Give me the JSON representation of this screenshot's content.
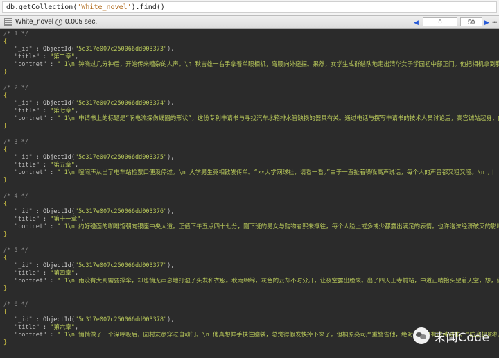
{
  "query": {
    "prefix": "db.getCollection(",
    "collection_arg": "'White_novel'",
    "suffix": ").find()"
  },
  "toolbar": {
    "collection_name": "White_novel",
    "elapsed": "0.005 sec.",
    "page_from": "0",
    "page_to": "50",
    "prev_label": "◀",
    "next_label": "▶",
    "more_label": "•••"
  },
  "documents": [
    {
      "comment": "/* 1 */",
      "id_value": "\"5c317e007c250066dd003373\"",
      "title": "\"第二章\"",
      "contnet": "\"    1\\n    钟晓过几分钟后，开始传来嘈杂的人声。\\n    秋吉雄一右手拿着单眼相机，弯腰向外窥探。果然，女学生成群结队地走出清华女子学园初中部正门。他把相机拿到胸前，"
    },
    {
      "comment": "/* 2 */",
      "id_value": "\"5c317e007c250066dd003374\"",
      "title": "\"第七章\"",
      "contnet": "\"    1\\n    申请书上的标题是“涡电流探伤线圈的形状”，这份专利申请书与寻找汽车水箱排水管缺损的器具有关。通过电话与撰写申请书的技术人员讨论后，高宫诚站起身，向并排摆"
    },
    {
      "comment": "/* 3 */",
      "id_value": "\"5c317e007c250066dd003375\"",
      "title": "\"第五章\"",
      "contnet": "\"    1\\n    喧闹声从出了电车站检票口便没停过。\\n    大学男生竟相散发传单。“××大学网球社，请看一看。”由于一直扯着嗓咙高声说话，每个人的声音都又粗又哑。\\n    川"
    },
    {
      "comment": "/* 4 */",
      "id_value": "\"5c317e007c250066dd003376\"",
      "title": "\"第十一章\"",
      "contnet": "\"    1\\n    约好碰面的咖啡馆朝向银座中央大道。正值下午五点四十七分，刚下班的男女与购物者熙来攘往，每个人脸上或多或少都露出满足的表情。也许泡沫经济破灭的影响还没有"
    },
    {
      "comment": "/* 5 */",
      "id_value": "\"5c317e007c250066dd003377\"",
      "title": "\"第四章\"",
      "contnet": "\"    1\\n    雨没有大到需要撑伞，却也悄无声息地打湿了头发和衣服。秋雨绵绵，灰色的云却不时分开，让夜空露出脸来。出了四天王寺前站，中道正晴抬头望着天空，想，狐狸嫁女"
    },
    {
      "comment": "/* 6 */",
      "id_value": "\"5c317e007c250066dd003378\"",
      "title": "\"第六章\"",
      "contnet": "\"    1\\n    悄悄做了一个深呼吸后，园村友彦穿过自动门。\\n    他真想伸手扶住脑袋，总觉得假发快掉下来了。但桐原亮司严重警告他，绝对不可以有这种动作。“防盗摄影机会把你频频触"
    }
  ],
  "labels": {
    "id_key": "\"_id\"",
    "title_key": "\"title\"",
    "contnet_key": "\"contnet\"",
    "colon": " : ",
    "comma": ",",
    "object_id_fn": "ObjectId",
    "open_paren": "(",
    "close_paren_comma": "),",
    "open_brace": "{",
    "close_brace": "}"
  },
  "watermark": {
    "text": "末闻Code"
  },
  "colors": {
    "background": "#2b2b2b",
    "string": "#b8c85a",
    "brace": "#d6c945",
    "comment": "#8b8b8b",
    "key": "#bdbdbd"
  }
}
